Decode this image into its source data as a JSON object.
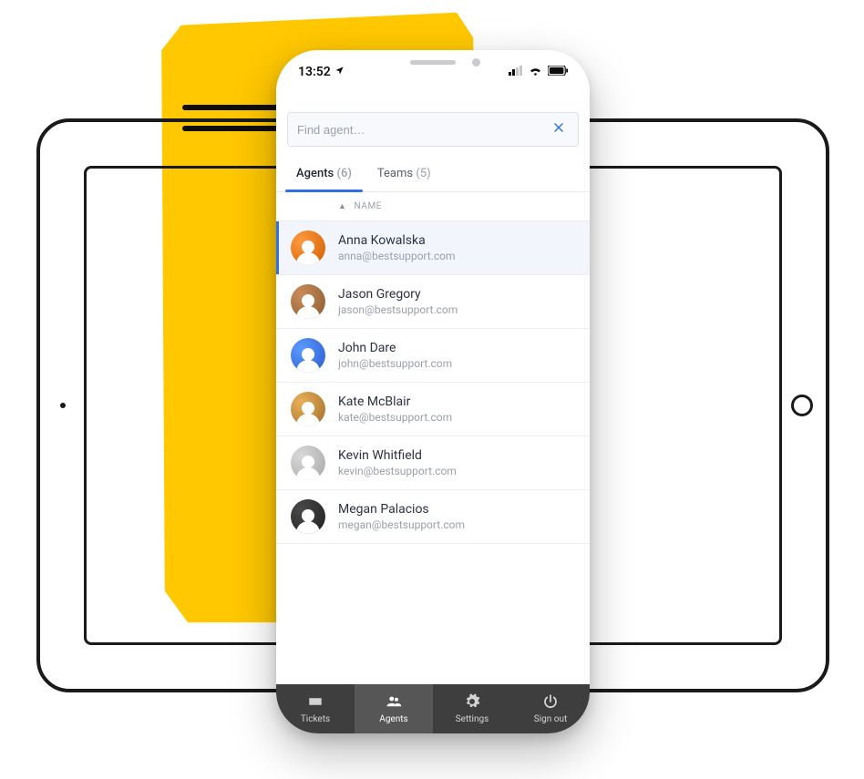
{
  "status": {
    "time": "13:52"
  },
  "search": {
    "placeholder": "Find agent…"
  },
  "tabs": {
    "agents": {
      "label": "Agents",
      "count": "(6)"
    },
    "teams": {
      "label": "Teams",
      "count": "(5)"
    }
  },
  "columns": {
    "name": "NAME"
  },
  "agents": [
    {
      "name": "Anna Kowalska",
      "email": "anna@bestsupport.com"
    },
    {
      "name": "Jason Gregory",
      "email": "jason@bestsupport.com"
    },
    {
      "name": "John Dare",
      "email": "john@bestsupport.com"
    },
    {
      "name": "Kate McBlair",
      "email": "kate@bestsupport.com"
    },
    {
      "name": "Kevin Whitfield",
      "email": "kevin@bestsupport.com"
    },
    {
      "name": "Megan Palacios",
      "email": "megan@bestsupport.com"
    }
  ],
  "nav": {
    "tickets": "Tickets",
    "agents": "Agents",
    "settings": "Settings",
    "signout": "Sign out"
  }
}
